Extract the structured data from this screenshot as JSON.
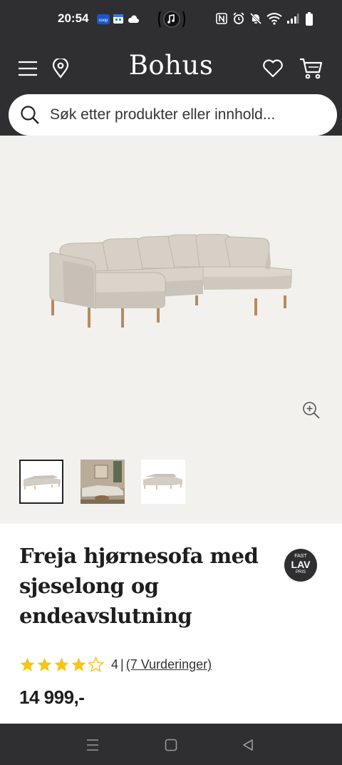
{
  "status_bar": {
    "time": "20:54",
    "carrier_badge": "coop"
  },
  "header": {
    "brand": "Bohus"
  },
  "search": {
    "placeholder": "Søk etter produkter eller innhold..."
  },
  "product": {
    "title_lines": [
      "Freja hjørnesofa med",
      "sjeselong og",
      "endeavslutning"
    ],
    "badge": {
      "top": "FAST",
      "middle": "LAV",
      "bottom": "PRIS"
    },
    "rating_value": "4",
    "rating_separator": "|",
    "rating_link": "(7 Vurderinger)",
    "rating_stars": 4,
    "rating_max": 5,
    "price": "14 999,-"
  },
  "gallery": {
    "thumbnail_count": 3,
    "selected_thumbnail": 1
  },
  "colors": {
    "header_bg": "#2f2f31",
    "gallery_bg": "#f3f1ee",
    "star": "#f5c518",
    "sofa": "#d3cdc4"
  },
  "icons": [
    "menu-icon",
    "location-pin-icon",
    "heart-icon",
    "cart-icon",
    "search-icon",
    "zoom-in-icon"
  ]
}
